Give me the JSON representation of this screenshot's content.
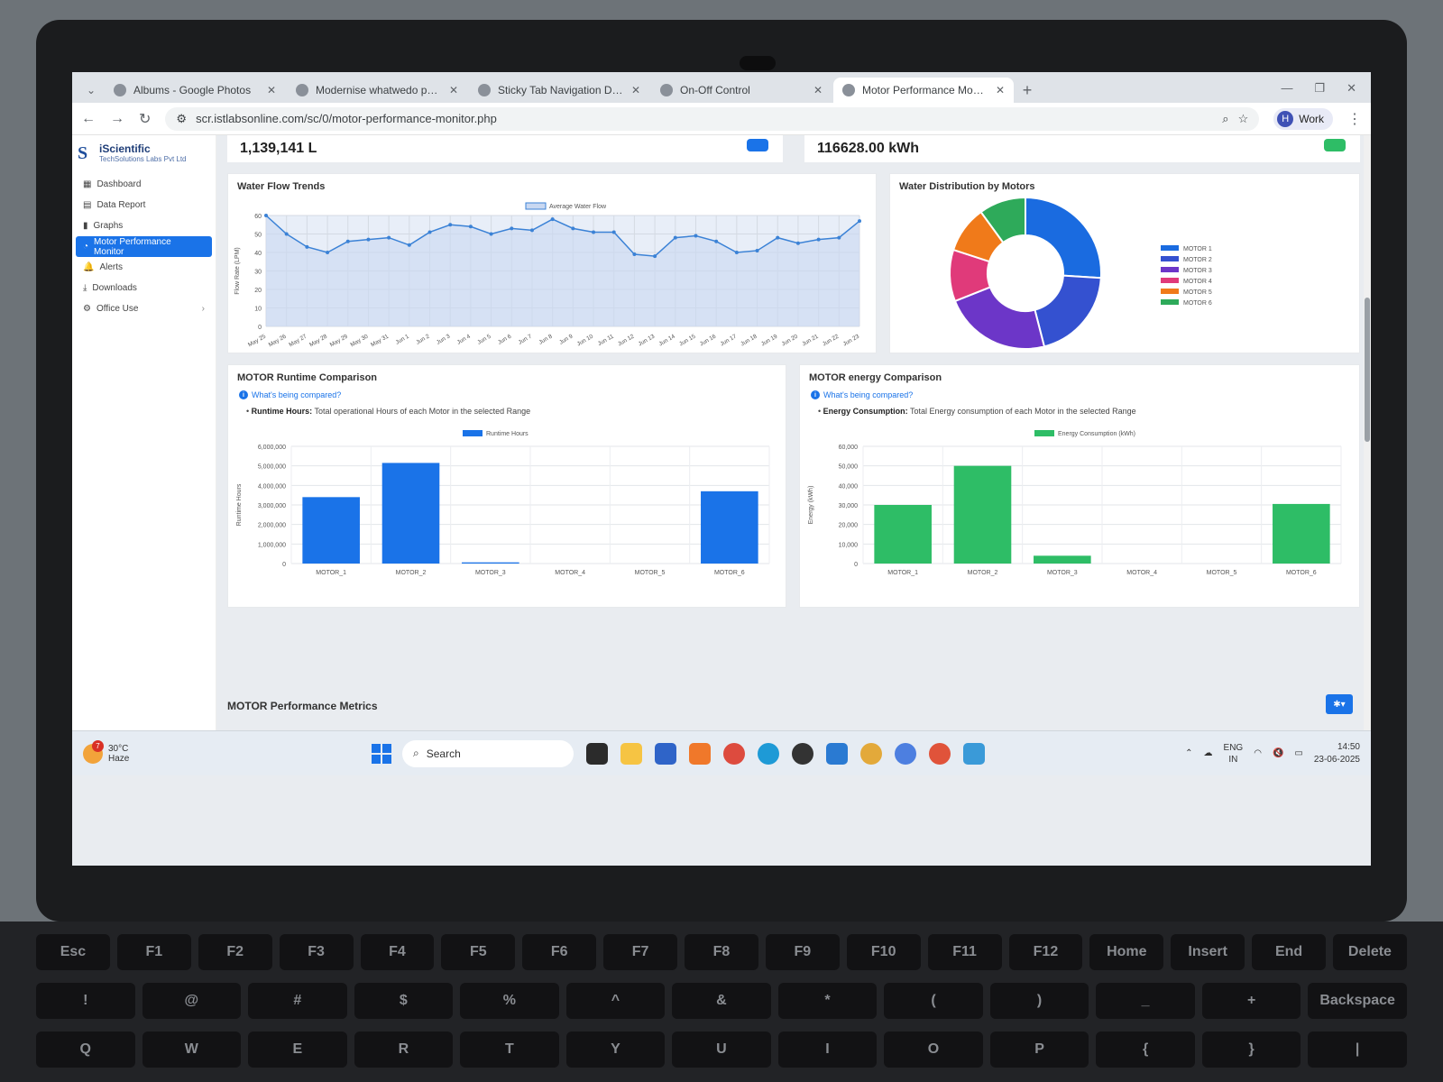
{
  "browser": {
    "tabs": [
      {
        "title": "Albums - Google Photos",
        "active": false
      },
      {
        "title": "Modernise whatwedo page – v",
        "active": false
      },
      {
        "title": "Sticky Tab Navigation Design -",
        "active": false
      },
      {
        "title": "On-Off Control",
        "active": false
      },
      {
        "title": "Motor Performance Monitor",
        "active": true
      }
    ],
    "url": "scr.istlabsonline.com/sc/0/motor-performance-monitor.php",
    "profile_initial": "H",
    "profile_label": "Work"
  },
  "brand": {
    "name": "iScientific",
    "tagline": "TechSolutions Labs Pvt Ltd"
  },
  "sidebar": {
    "items": [
      {
        "label": "Dashboard",
        "icon": "grid-icon",
        "active": false
      },
      {
        "label": "Data Report",
        "icon": "table-icon",
        "active": false
      },
      {
        "label": "Graphs",
        "icon": "bar-chart-icon",
        "active": false
      },
      {
        "label": "Motor Performance Monitor",
        "icon": "gauge-icon",
        "active": true
      },
      {
        "label": "Alerts",
        "icon": "bell-icon",
        "active": false
      },
      {
        "label": "Downloads",
        "icon": "download-icon",
        "active": false
      },
      {
        "label": "Office Use",
        "icon": "gear-icon",
        "active": false,
        "has_submenu": true
      }
    ]
  },
  "stats": {
    "water_total": "1,139,141 L",
    "energy_total": "116628.00 kWh"
  },
  "sections": {
    "flow_title": "Water Flow Trends",
    "distribution_title": "Water Distribution by Motors",
    "runtime_title": "MOTOR Runtime Comparison",
    "energy_title": "MOTOR energy Comparison",
    "metrics_title": "MOTOR Performance Metrics",
    "runtime_info": "What's being compared?",
    "runtime_desc_bold": "Runtime Hours:",
    "runtime_desc": " Total operational Hours of each Motor in the selected Range",
    "energy_info": "What's being compared?",
    "energy_desc_bold": "Energy Consumption:",
    "energy_desc": " Total Energy consumption of each Motor in the selected Range"
  },
  "colors": {
    "primary": "#1a73e8",
    "green": "#2ebd66",
    "line": "#3b82d6"
  },
  "chart_data": [
    {
      "type": "line",
      "title": "Water Flow Trends",
      "ylabel": "Flow Rate (LPM)",
      "series_name": "Average Water Flow",
      "ylim": [
        0,
        60
      ],
      "yticks": [
        0,
        10,
        20,
        30,
        40,
        50,
        60
      ],
      "x": [
        "May 25",
        "May 26",
        "May 27",
        "May 28",
        "May 29",
        "May 30",
        "May 31",
        "Jun 1",
        "Jun 2",
        "Jun 3",
        "Jun 4",
        "Jun 5",
        "Jun 6",
        "Jun 7",
        "Jun 8",
        "Jun 9",
        "Jun 10",
        "Jun 11",
        "Jun 12",
        "Jun 13",
        "Jun 14",
        "Jun 15",
        "Jun 16",
        "Jun 17",
        "Jun 18",
        "Jun 19",
        "Jun 20",
        "Jun 21",
        "Jun 22",
        "Jun 23"
      ],
      "values": [
        60,
        50,
        43,
        40,
        46,
        47,
        48,
        44,
        51,
        55,
        54,
        50,
        53,
        52,
        58,
        53,
        51,
        51,
        39,
        38,
        48,
        49,
        46,
        40,
        41,
        48,
        45,
        47,
        48,
        57
      ],
      "grid": true
    },
    {
      "type": "pie",
      "title": "Water Distribution by Motors",
      "hole": true,
      "categories": [
        "MOTOR 1",
        "MOTOR 2",
        "MOTOR 3",
        "MOTOR 4",
        "MOTOR 5",
        "MOTOR 6"
      ],
      "values": [
        26,
        20,
        23,
        11,
        10,
        10
      ],
      "colors": [
        "#1a6be0",
        "#3451d0",
        "#6c36c8",
        "#e03a7a",
        "#f07a1a",
        "#2eaa5a"
      ],
      "legend": "right"
    },
    {
      "type": "bar",
      "title": "MOTOR Runtime Comparison",
      "ylabel": "Runtime Hours",
      "series_name": "Runtime Hours",
      "categories": [
        "MOTOR_1",
        "MOTOR_2",
        "MOTOR_3",
        "MOTOR_4",
        "MOTOR_5",
        "MOTOR_6"
      ],
      "values": [
        3400000,
        5150000,
        60000,
        0,
        0,
        3700000
      ],
      "ylim": [
        0,
        6000000
      ],
      "yticks": [
        "0",
        "1,000,000",
        "2,000,000",
        "3,000,000",
        "4,000,000",
        "5,000,000",
        "6,000,000"
      ],
      "color": "#1a73e8"
    },
    {
      "type": "bar",
      "title": "MOTOR energy Comparison",
      "ylabel": "Energy (kWh)",
      "series_name": "Energy Consumption (kWh)",
      "categories": [
        "MOTOR_1",
        "MOTOR_2",
        "MOTOR_3",
        "MOTOR_4",
        "MOTOR_5",
        "MOTOR_6"
      ],
      "values": [
        30000,
        50000,
        4000,
        0,
        0,
        30500
      ],
      "ylim": [
        0,
        60000
      ],
      "yticks": [
        "0",
        "10,000",
        "20,000",
        "30,000",
        "40,000",
        "50,000",
        "60,000"
      ],
      "color": "#2ebd66"
    }
  ],
  "taskbar": {
    "temp": "30°C",
    "condition": "Haze",
    "weather_badge": "7",
    "search_placeholder": "Search",
    "lang": "ENG",
    "region": "IN",
    "time": "14:50",
    "date": "23-06-2025"
  },
  "keyboard": {
    "row1": [
      "Esc",
      "F1",
      "F2",
      "F3",
      "F4",
      "F5",
      "F6",
      "F7",
      "F8",
      "F9",
      "F10",
      "F11",
      "F12",
      "Home",
      "Insert",
      "End",
      "Delete"
    ],
    "row2": [
      "!",
      "@",
      "#",
      "$",
      "%",
      "^",
      "&",
      "*",
      "(",
      ")",
      "_",
      "+",
      "Backspace"
    ],
    "row3": [
      "Q",
      "W",
      "E",
      "R",
      "T",
      "Y",
      "U",
      "I",
      "O",
      "P",
      "{",
      "}",
      "|"
    ]
  }
}
